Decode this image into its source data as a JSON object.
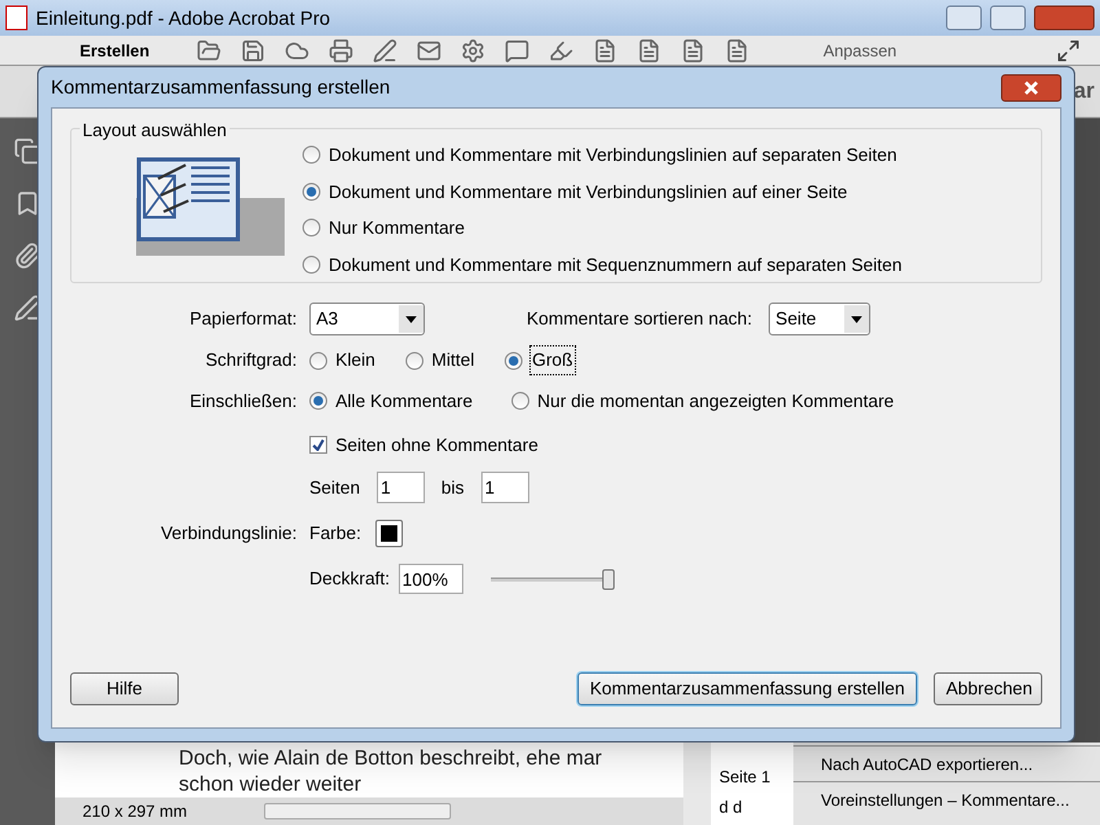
{
  "window": {
    "title": "Einleitung.pdf - Adobe Acrobat Pro"
  },
  "toolbar": {
    "create_label": "Erstellen",
    "customize_label": "Anpassen",
    "cut_label": "ar"
  },
  "document": {
    "lines": [
      "Doch, wie Alain de Botton beschreibt, ehe mar",
      "schon wieder weiter"
    ],
    "page_size": "210 x 297 mm"
  },
  "side_panel": {
    "page_label": "Seite 1",
    "marks": "d d",
    "menu_items": [
      "Nach AutoCAD exportieren...",
      "Voreinstellungen – Kommentare..."
    ]
  },
  "dialog": {
    "title": "Kommentarzusammenfassung erstellen",
    "layout_group": {
      "title": "Layout auswählen",
      "options": [
        {
          "label": "Dokument und Kommentare mit Verbindungslinien auf separaten Seiten",
          "selected": false
        },
        {
          "label": "Dokument und Kommentare mit Verbindungslinien auf einer Seite",
          "selected": true
        },
        {
          "label": "Nur Kommentare",
          "selected": false
        },
        {
          "label": "Dokument und Kommentare mit Sequenznummern auf separaten Seiten",
          "selected": false
        }
      ]
    },
    "paper_format": {
      "label": "Papierformat:",
      "value": "A3"
    },
    "sort_by": {
      "label": "Kommentare sortieren nach:",
      "value": "Seite"
    },
    "font_size": {
      "label": "Schriftgrad:",
      "options": [
        {
          "label": "Klein",
          "selected": false
        },
        {
          "label": "Mittel",
          "selected": false
        },
        {
          "label": "Groß",
          "selected": true
        }
      ]
    },
    "include": {
      "label": "Einschließen:",
      "options": [
        {
          "label": "Alle Kommentare",
          "selected": true
        },
        {
          "label": "Nur die momentan angezeigten Kommentare",
          "selected": false
        }
      ]
    },
    "pages_without_comments": {
      "label": "Seiten ohne Kommentare",
      "checked": true
    },
    "pages": {
      "label": "Seiten",
      "from": "1",
      "to_label": "bis",
      "to": "1"
    },
    "connector": {
      "label": "Verbindungslinie:",
      "color_label": "Farbe:",
      "color": "#000000"
    },
    "opacity": {
      "label": "Deckkraft:",
      "value": "100%",
      "level": 1
    },
    "buttons": [
      {
        "label": "Hilfe",
        "default": false
      },
      {
        "label": "Kommentarzusammenfassung erstellen",
        "default": true
      },
      {
        "label": "Abbrechen",
        "default": false
      }
    ]
  }
}
